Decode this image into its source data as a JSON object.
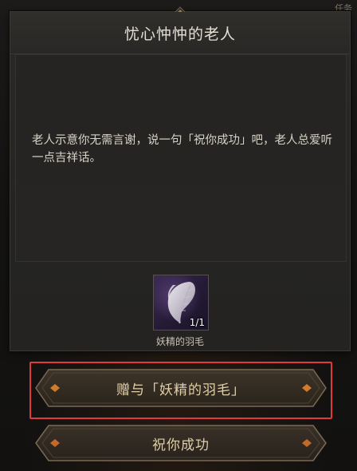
{
  "corner": {
    "text": "任务"
  },
  "dialog": {
    "title": "忧心忡忡的老人",
    "message": "老人示意你无需言谢，说一句「祝你成功」吧，老人总爱听一点吉祥话。"
  },
  "item": {
    "icon": "feather-icon",
    "count": "1/1",
    "name": "妖精的羽毛"
  },
  "buttons": {
    "gift_label": "赠与「妖精的羽毛」",
    "wish_label": "祝你成功"
  },
  "colors": {
    "highlight": "#e23a3a",
    "button_text": "#e0cfa6",
    "item_bg": "#3c2a55"
  }
}
